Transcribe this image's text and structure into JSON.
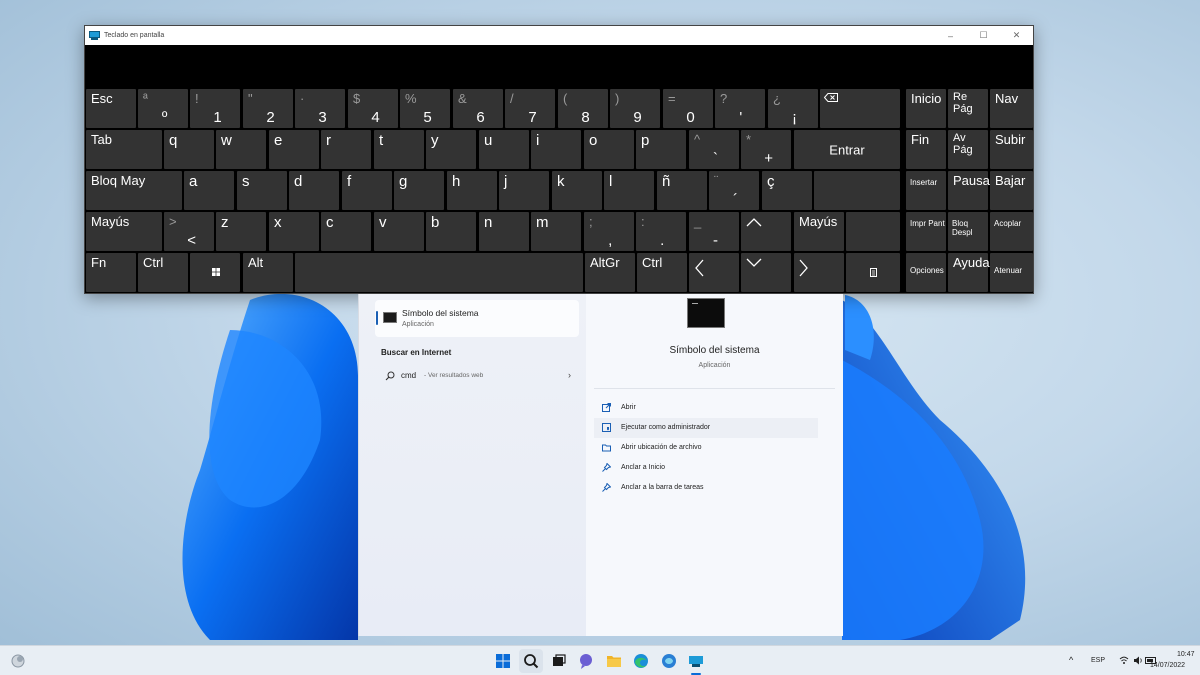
{
  "window": {
    "title": "Teclado en pantalla",
    "controls": [
      "–",
      "☐",
      "✕"
    ]
  },
  "keyboard": {
    "row1": [
      {
        "id": "esc",
        "main": "Esc"
      },
      {
        "id": "ordinal",
        "top": "ª",
        "bot": "º"
      },
      {
        "id": "1",
        "top": "!",
        "bot": "1"
      },
      {
        "id": "2",
        "top": "\"",
        "bot": "2"
      },
      {
        "id": "3",
        "top": "·",
        "bot": "3"
      },
      {
        "id": "4",
        "top": "$",
        "bot": "4"
      },
      {
        "id": "5",
        "top": "%",
        "bot": "5"
      },
      {
        "id": "6",
        "top": "&",
        "bot": "6"
      },
      {
        "id": "7",
        "top": "/",
        "bot": "7"
      },
      {
        "id": "8",
        "top": "(",
        "bot": "8"
      },
      {
        "id": "9",
        "top": ")",
        "bot": "9"
      },
      {
        "id": "0",
        "top": "=",
        "bot": "0"
      },
      {
        "id": "apostrophe",
        "top": "?",
        "bot": "'"
      },
      {
        "id": "inverted-question",
        "top": "¿",
        "bot": "¡"
      }
    ],
    "row2": [
      "Tab",
      "q",
      "w",
      "e",
      "r",
      "t",
      "y",
      "u",
      "i",
      "o",
      "p"
    ],
    "row2_extra": [
      {
        "id": "caret",
        "top": "^",
        "bot": "`"
      },
      {
        "id": "asterisk",
        "top": "*",
        "bot": "+"
      }
    ],
    "enter": "Entrar",
    "row3": [
      "Bloq May",
      "a",
      "s",
      "d",
      "f",
      "g",
      "h",
      "j",
      "k",
      "l",
      "ñ"
    ],
    "row3_extra": [
      {
        "id": "dieresis",
        "top": "¨",
        "bot": "´"
      },
      {
        "id": "cedilla",
        "top": "",
        "bot": "ç"
      }
    ],
    "row4": [
      "Mayús"
    ],
    "row4_less": {
      "top": ">",
      "bot": "<"
    },
    "row4_letters": [
      "z",
      "x",
      "c",
      "v",
      "b",
      "n",
      "m"
    ],
    "row4_punct": [
      {
        "id": "comma",
        "top": ";",
        "bot": ","
      },
      {
        "id": "period",
        "top": ":",
        "bot": "."
      },
      {
        "id": "dash",
        "top": "_",
        "bot": "-"
      }
    ],
    "row4_right": "Mayús",
    "row5": {
      "fn": "Fn",
      "ctrl": "Ctrl",
      "alt": "Alt",
      "altgr": "AltGr",
      "ctrl2": "Ctrl"
    },
    "nav": {
      "inicio": "Inicio",
      "repag": "Re Pág",
      "nav": "Nav",
      "fin": "Fin",
      "avpag": "Av Pág",
      "subir": "Subir",
      "insertar": "Insertar",
      "pausa": "Pausa",
      "bajar": "Bajar",
      "imprpant": "Impr Pant",
      "bloqdespl": "Bloq Despl",
      "acoplar": "Acoplar",
      "opciones": "Opciones",
      "ayuda": "Ayuda",
      "atenuar": "Atenuar"
    }
  },
  "search": {
    "best_match_title": "Símbolo del sistema",
    "best_match_sub": "Aplicación",
    "web_section": "Buscar en Internet",
    "query": "cmd",
    "query_hint": " - Ver resultados web",
    "detail_title": "Símbolo del sistema",
    "detail_sub": "Aplicación",
    "actions": [
      "Abrir",
      "Ejecutar como administrador",
      "Abrir ubicación de archivo",
      "Anclar a Inicio",
      "Anclar a la barra de tareas"
    ]
  },
  "taskbar": {
    "lang": "ESP",
    "time": "10:47",
    "date": "14/07/2022"
  },
  "colors": {
    "accent": "#1a5fb4",
    "key": "#333333",
    "bloom": "#0a6ff2"
  }
}
